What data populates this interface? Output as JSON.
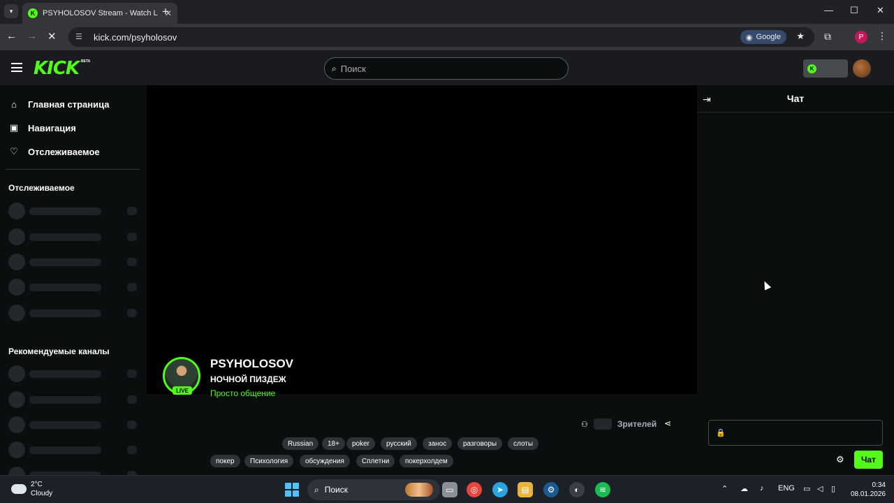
{
  "browser": {
    "tab_title": "PSYHOLOSOV Stream - Watch L",
    "url": "kick.com/psyholosov",
    "lens_label": "Google",
    "profile_initial": "P"
  },
  "kick": {
    "search_placeholder": "Поиск",
    "logo_text": "KICK",
    "logo_badge": "BETA",
    "sidebar": {
      "links": [
        {
          "label": "Главная страница",
          "icon": "home-icon"
        },
        {
          "label": "Навигация",
          "icon": "browse-icon"
        },
        {
          "label": "Отслеживаемое",
          "icon": "heart-icon"
        }
      ],
      "following_heading": "Отслеживаемое",
      "recommended_heading": "Рекомендуемые каналы"
    },
    "stream": {
      "streamer": "PSYHOLOSOV",
      "title": "НОЧНОЙ ПИЗДЕЖ",
      "category": "Просто общение",
      "live_label": "LIVE",
      "viewers_label": "Зрителей",
      "tags_row1": [
        "Russian",
        "18+",
        "poker",
        "русский",
        "занос",
        "разговоры",
        "слоты"
      ],
      "tags_row2": [
        "покер",
        "Психология",
        "обсуждения",
        "Сплетни",
        "покерхолдем"
      ]
    },
    "chat": {
      "title": "Чат",
      "send_label": "Чат"
    }
  },
  "taskbar": {
    "weather_temp": "2°C",
    "weather_desc": "Cloudy",
    "search_label": "Поиск",
    "language": "ENG",
    "time": "0:34",
    "date": "08.01.2026"
  },
  "colors": {
    "kick_green": "#53fc18",
    "background": "#0b0e0f",
    "nav_bg": "#191b1f"
  }
}
